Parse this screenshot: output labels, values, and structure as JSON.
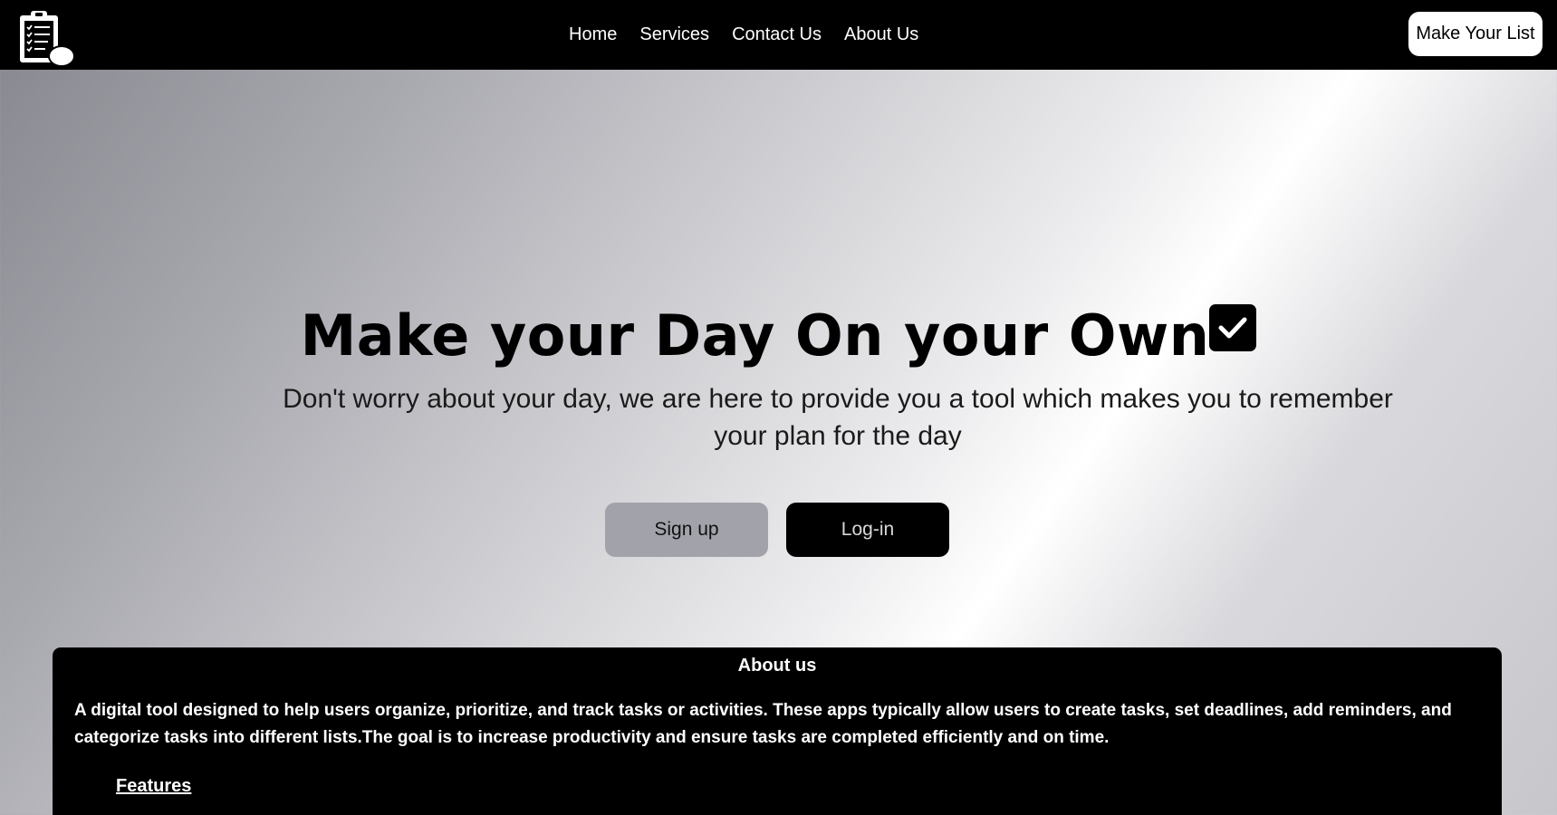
{
  "nav": {
    "logo_icon": "clipboard-checklist-icon",
    "links": [
      "Home",
      "Services",
      "Contact Us",
      "About Us"
    ],
    "cta": "Make Your List"
  },
  "hero": {
    "title": "Make your Day On your Own",
    "title_icon": "checkbox-checked-icon",
    "subtitle": "Don't worry about your day, we are here to provide you a tool which makes you to remember your plan for the day",
    "signup": "Sign up",
    "login": "Log-in"
  },
  "about": {
    "heading": "About us",
    "text": "A digital tool designed to help users organize, prioritize, and track tasks or activities. These apps typically allow users to create tasks, set deadlines, add reminders, and categorize tasks into different lists.The goal is to increase productivity and ensure tasks are completed efficiently and on time.",
    "features": "Features"
  },
  "colors": {
    "nav_bg": "#000000",
    "signup_bg": "#a2a2aa",
    "login_bg": "#000000",
    "card_bg": "#000000"
  }
}
